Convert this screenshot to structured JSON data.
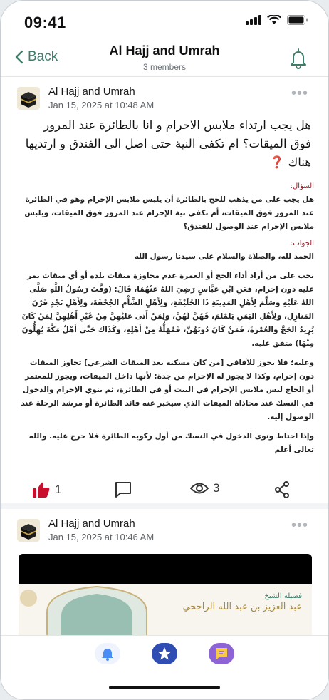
{
  "status": {
    "time": "09:41"
  },
  "nav": {
    "back_label": "Back",
    "title": "Al Hajj and Umrah",
    "subtitle": "3 members"
  },
  "posts": [
    {
      "author": "Al Hajj and Umrah",
      "date": "Jan 15, 2025 at 10:48 AM",
      "question": "هل يجب ارتداء ملابس الاحرام و انا بالطائرة عند المرور فوق الميقات؟ ام تكفى النية حتى اصل الى الفندق و ارتديها هناك ❓",
      "scan": {
        "q_head": "السؤال:",
        "q_text": "هل يجب على من يذهب للحج بالطائرة أن يلبس ملابس الإحرام وهو في الطائرة عند المرور فوق الميقات، أم تكفي نية الإحرام عند المرور فوق الميقات، ويلبس ملابس الإحرام عند الوصول للفندق؟",
        "a_head": "الجواب:",
        "a_intro": "الحمد لله، والصلاة والسلام على سيدنا رسول الله",
        "a_p1": "يجب على من أراد أداء الحج أو العمرة عدم مجاوزة ميقات بلده أو أي ميقات يمر عليه دون إحرام، فعَنِ ابْنِ عَبَّاسٍ رَضِيَ اللهُ عَنْهُمَا، قَالَ: (وَقَّتَ رَسُولُ اللَّهِ صَلَّى اللهُ عَلَيْهِ وَسَلَّمَ لِأَهْلِ المَدِينَةِ ذَا الحُلَيْفَةِ، وَلِأَهْلِ الشَّأْمِ الجُحْفَةَ، وَلِأَهْلِ نَجْدٍ قَرْنَ المَنَازِلِ، وَلِأَهْلِ اليَمَنِ يَلَمْلَمَ، فَهُنَّ لَهُنَّ، وَلِمَنْ أَتَى عَلَيْهِنَّ مِنْ غَيْرِ أَهْلِهِنَّ لِمَنْ كَانَ يُرِيدُ الحَجَّ وَالعُمْرَةَ، فَمَنْ كَانَ دُونَهُنَّ، فَمُهَلُّهُ مِنْ أَهْلِهِ، وَكَذَاكَ حَتَّى أَهْلُ مَكَّةَ يُهِلُّونَ مِنْهَا) متفق عليه.",
        "a_p2": "وعليه؛ فلا يجوز للآفاقي [من كان مسكنه بعد الميقات الشرعي] تجاوز الميقات دون إحرام، وكذا لا يجوز له الإحرام من جدة؛ لأنها داخل الميقات، ويجوز للمعتمر أو الحاج لبس ملابس الإحرام في البيت أو في الطائرة، ثم ينوي الإحرام والدخول في النسك عند محاذاة الميقات الذي سيخبر عنه قائد الطائرة أو مرشد الرحلة عند الوصول إليه.",
        "a_p3": "وإذا احتاط ونوى الدخول في النسك من أول ركوبه الطائرة فلا حرج عليه. والله تعالى أعلم"
      },
      "likes": "1",
      "views": "3"
    },
    {
      "author": "Al Hajj and Umrah",
      "date": "Jan 15, 2025 at 10:46 AM",
      "media_caption_1": "فضيلة الشيخ",
      "media_caption_2": "عبد العزيز بن عبد الله الراجحي"
    }
  ],
  "colors": {
    "accent": "#3f7d6b",
    "like": "#c8102e",
    "tab_bell": "#4a8df6",
    "tab_star": "#2f4db3",
    "tab_chat": "#8d63d6"
  }
}
